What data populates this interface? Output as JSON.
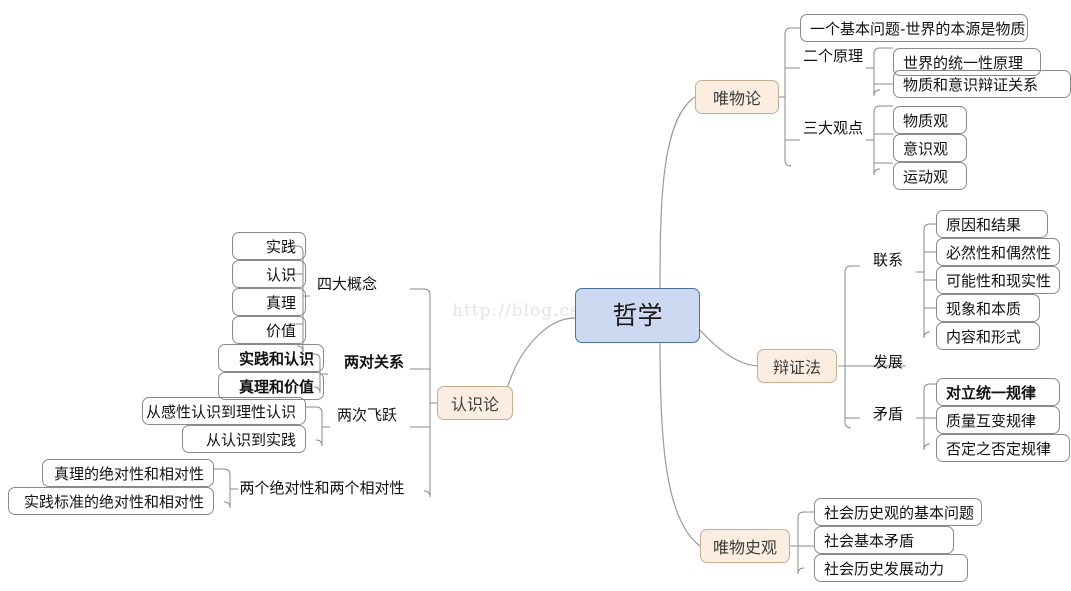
{
  "watermark": "http://blog.csdn.net/",
  "colors": {
    "root_fill": "#ccd9f0",
    "root_border": "#4472a8",
    "branch_fill": "#fbeee1",
    "branch_border": "#c9ab8d",
    "leaf_border": "#8a8a8a",
    "link": "#9a9a9a",
    "text": "#111111",
    "watermark": "#e3e3e3"
  },
  "root": {
    "label": "哲学"
  },
  "branches": {
    "weiwulun": {
      "label": "唯物论",
      "groups": [
        {
          "label": "一个基本问题-世界的本源是物质",
          "type": "direct"
        },
        {
          "label": "二个原理",
          "children": [
            "世界的统一性原理",
            "物质和意识辩证关系"
          ]
        },
        {
          "label": "三大观点",
          "children": [
            "物质观",
            "意识观",
            "运动观"
          ]
        }
      ]
    },
    "bianzhengfa": {
      "label": "辩证法",
      "groups": [
        {
          "label": "联系",
          "children": [
            "原因和结果",
            "必然性和偶然性",
            "可能性和现实性",
            "现象和本质",
            "内容和形式"
          ]
        },
        {
          "label": "发展",
          "children": []
        },
        {
          "label": "矛盾",
          "children": [
            "对立统一规律",
            "质量互变规律",
            "否定之否定规律"
          ]
        }
      ]
    },
    "weiwushiguan": {
      "label": "唯物史观",
      "groups": [
        {
          "label": "社会历史观的基本问题",
          "type": "direct"
        },
        {
          "label": "社会基本矛盾",
          "type": "direct"
        },
        {
          "label": "社会历史发展动力",
          "type": "direct"
        }
      ]
    },
    "renshilun": {
      "label": "认识论",
      "groups": [
        {
          "label": "四大概念",
          "children": [
            "实践",
            "认识",
            "真理",
            "价值"
          ]
        },
        {
          "label": "两对关系",
          "children": [
            "实践和认识",
            "真理和价值"
          ],
          "bold": true
        },
        {
          "label": "两次飞跃",
          "children": [
            "从感性认识到理性认识",
            "从认识到实践"
          ]
        },
        {
          "label": "两个绝对性和两个相对性",
          "children": [
            "真理的绝对性和相对性",
            "实践标准的绝对性和相对性"
          ]
        }
      ]
    }
  },
  "leaves": {
    "wwl_q1": "一个基本问题-世界的本源是物质",
    "wwl_p1": "世界的统一性原理",
    "wwl_p2": "物质和意识辩证关系",
    "wwl_v1": "物质观",
    "wwl_v2": "意识观",
    "wwl_v3": "运动观",
    "bzf_l1": "原因和结果",
    "bzf_l2": "必然性和偶然性",
    "bzf_l3": "可能性和现实性",
    "bzf_l4": "现象和本质",
    "bzf_l5": "内容和形式",
    "bzf_m1": "对立统一规律",
    "bzf_m2": "质量互变规律",
    "bzf_m3": "否定之否定规律",
    "wsg_1": "社会历史观的基本问题",
    "wsg_2": "社会基本矛盾",
    "wsg_3": "社会历史发展动力",
    "rsl_c1": "实践",
    "rsl_c2": "认识",
    "rsl_c3": "真理",
    "rsl_c4": "价值",
    "rsl_r1": "实践和认识",
    "rsl_r2": "真理和价值",
    "rsl_f1": "从感性认识到理性认识",
    "rsl_f2": "从认识到实践",
    "rsl_a1": "真理的绝对性和相对性",
    "rsl_a2": "实践标准的绝对性和相对性"
  },
  "mid_labels": {
    "wwl_principles": "二个原理",
    "wwl_views": "三大观点",
    "bzf_lianxi": "联系",
    "bzf_fazhan": "发展",
    "bzf_maodun": "矛盾",
    "rsl_concepts": "四大概念",
    "rsl_relations": "两对关系",
    "rsl_leaps": "两次飞跃",
    "rsl_absolutes": "两个绝对性和两个相对性"
  }
}
